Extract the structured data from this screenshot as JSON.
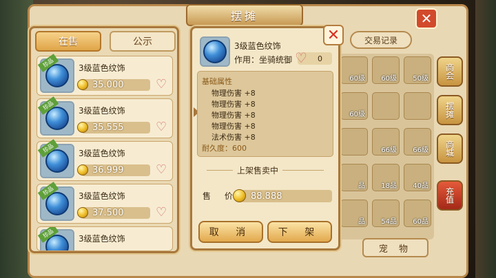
{
  "window": {
    "title": "摆摊",
    "close_icon": "close-x-icon"
  },
  "list_panel": {
    "tabs": [
      {
        "label": "在售",
        "active": true
      },
      {
        "label": "公示",
        "active": false
      }
    ],
    "items": [
      {
        "badge": "珍品",
        "name": "3级蓝色纹饰",
        "price": "35.000"
      },
      {
        "badge": "珍品",
        "name": "3级蓝色纹饰",
        "price": "35.555"
      },
      {
        "badge": "珍品",
        "name": "3级蓝色纹饰",
        "price": "36.999"
      },
      {
        "badge": "珍品",
        "name": "3级蓝色纹饰",
        "price": "37.500"
      },
      {
        "badge": "珍品",
        "name": "3级蓝色纹饰",
        "price": ""
      }
    ]
  },
  "detail": {
    "title": "3级蓝色纹饰",
    "usage": "作用：坐骑统御",
    "favorite_count": "0",
    "attributes_header": "基础属性",
    "attributes": [
      "物理伤害 +8",
      "物理伤害 +8",
      "物理伤害 +8",
      "物理伤害 +8",
      "法术伤害 +8"
    ],
    "durability": "耐久度：600",
    "status": "上架售卖中",
    "price_label": "售 价",
    "price": "88.888",
    "cancel_label": "取 消",
    "delist_label": "下 架"
  },
  "right_panel": {
    "record_label": "交易记录",
    "grid_labels": [
      "60级",
      "60级",
      "50级",
      "60级",
      "",
      "",
      "",
      "66级",
      "66级",
      "品",
      "18品",
      "40品",
      "品",
      "54品",
      "60品"
    ],
    "side_tabs": [
      "商会",
      "摆摊",
      "商城",
      "充值"
    ],
    "pet_label": "宠 物"
  },
  "colors": {
    "accent": "#e0a548",
    "frame": "#a8773c",
    "close": "#d63224"
  }
}
